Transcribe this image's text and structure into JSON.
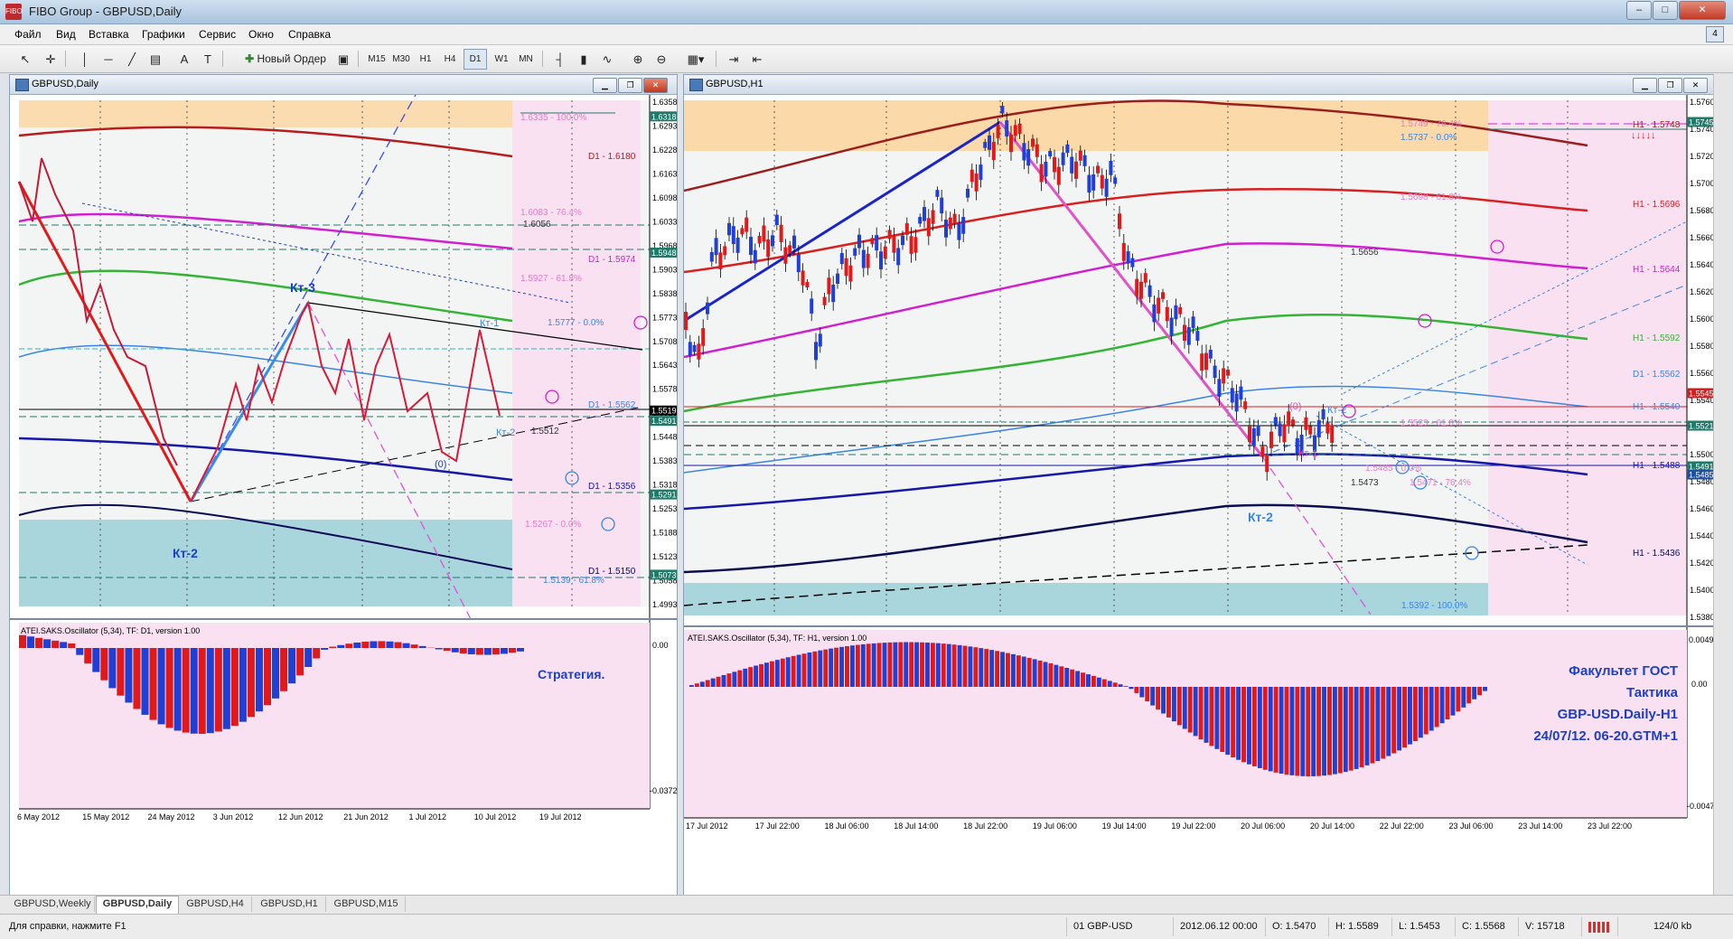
{
  "window": {
    "title": "FIBO Group - GBPUSD,Daily",
    "app_icon": "FIBO"
  },
  "menu": [
    "Файл",
    "Вид",
    "Вставка",
    "Графики",
    "Сервис",
    "Окно",
    "Справка"
  ],
  "toolbar": {
    "new_order_label": "Новый Ордер",
    "timeframes": [
      "M15",
      "M30",
      "H1",
      "H4",
      "D1",
      "W1",
      "MN"
    ],
    "active_timeframe": "D1",
    "icons": [
      "cursor-icon",
      "crosshair-icon",
      "vertical-line-icon",
      "horizontal-line-icon",
      "trendline-icon",
      "channel-icon",
      "text-icon",
      "label-icon",
      "bar-chart-icon",
      "candle-chart-icon",
      "line-chart-icon",
      "zoom-in-icon",
      "zoom-out-icon",
      "window-tile-icon",
      "autoscroll-icon",
      "shift-chart-icon"
    ]
  },
  "left_chart": {
    "title": "GBPUSD,Daily",
    "oscillator_label": "ATEI.SAKS.Oscillator (5,34), TF: D1, version 1.00",
    "osc_axis": {
      "top": "0.00",
      "bottom": "-0.03724"
    },
    "annotation_strategy": "Стратегия.",
    "waves": {
      "kt3": "Кт-3",
      "kt2": "Кт-2",
      "kt1": "Кт-1",
      "kt2b": "Кт-2",
      "zero": "(0)"
    },
    "price_axis": [
      "1.6358",
      "1.6293",
      "1.6228",
      "1.6163",
      "1.6098",
      "1.6033",
      "1.5968",
      "1.5903",
      "1.5838",
      "1.5773",
      "1.5708",
      "1.5643",
      "1.5578",
      "1.5513",
      "1.5448",
      "1.5383",
      "1.5318",
      "1.5253",
      "1.5188",
      "1.5123",
      "1.5058",
      "1.4993"
    ],
    "price_tags": [
      {
        "text": "1.6318",
        "color": "#1f7a6a"
      },
      {
        "text": "1.5948",
        "color": "#1f7a6a"
      },
      {
        "text": "1.5519",
        "color": "#000000"
      },
      {
        "text": "1.5491",
        "color": "#1f7a6a"
      },
      {
        "text": "1.5291",
        "color": "#1f7a6a"
      },
      {
        "text": "1.5073",
        "color": "#1f7a6a"
      }
    ],
    "level_labels": [
      "1.6335 - 100.0%",
      "D1 - 1.6180",
      "1.6083 - 76.4%",
      "1.6056",
      "D1 - 1.5974",
      "1.5927 - 61.8%",
      "1.5777 - 0.0%",
      "D1 - 1.5562",
      "1.5512",
      "D1 - 1.5356",
      "1.5267 - 0.0%",
      "D1 - 1.5150",
      "1.5139 - 61.8%"
    ],
    "dates": [
      "6 May 2012",
      "15 May 2012",
      "24 May 2012",
      "3 Jun 2012",
      "12 Jun 2012",
      "21 Jun 2012",
      "1 Jul 2012",
      "10 Jul 2012",
      "19 Jul 2012"
    ]
  },
  "right_chart": {
    "title": "GBPUSD,H1",
    "oscillator_label": "ATEI.SAKS.Oscillator (5,34), TF: H1, version 1.00",
    "osc_axis": {
      "top": "0.00491",
      "mid": "0.00",
      "bottom": "-0.00478"
    },
    "price_axis": [
      "1.5760",
      "1.5740",
      "1.5720",
      "1.5700",
      "1.5680",
      "1.5660",
      "1.5640",
      "1.5620",
      "1.5600",
      "1.5580",
      "1.5560",
      "1.5540",
      "1.5520",
      "1.5500",
      "1.5480",
      "1.5460",
      "1.5440",
      "1.5420",
      "1.5400",
      "1.5380"
    ],
    "price_tags": [
      {
        "text": "1.5745",
        "color": "#1f7a6a"
      },
      {
        "text": "1.5545",
        "color": "#d02020"
      },
      {
        "text": "1.5521",
        "color": "#1f7a6a"
      },
      {
        "text": "1.5491",
        "color": "#1f7a6a"
      },
      {
        "text": "1.5485",
        "color": "#1f4fa0"
      }
    ],
    "level_labels": [
      "1.5749 - 76.4%",
      "1.5737 - 0.0%",
      "H1 - 1.5748",
      "1.5698 - 61.8%",
      "H1 - 1.5696",
      "1.5656",
      "H1 - 1.5644",
      "H1 - 1.5592",
      "D1 - 1.5562",
      "H1 - 1.5540",
      "1.5523 - 61.8%",
      "H1 - 1.5488",
      "1.5485 - 0.0%",
      "1.5473",
      "1.5471 - 76.4%",
      "H1 - 1.5436",
      "1.5392 - 100.0%"
    ],
    "waves": {
      "kt2": "Кт-2",
      "kt1": "Кт-1",
      "kt2b": "Кт-2",
      "zero": "(0)"
    },
    "dates": [
      "17 Jul 2012",
      "17 Jul 22:00",
      "18 Jul 06:00",
      "18 Jul 14:00",
      "18 Jul 22:00",
      "19 Jul 06:00",
      "19 Jul 14:00",
      "19 Jul 22:00",
      "20 Jul 06:00",
      "20 Jul 14:00",
      "22 Jul 22:00",
      "23 Jul 06:00",
      "23 Jul 14:00",
      "23 Jul 22:00"
    ],
    "caption": [
      "Факультет ГОСТ",
      "Тактика",
      "GBP-USD.Daily-H1",
      "24/07/12. 06-20.GTM+1"
    ]
  },
  "tabs": [
    "GBPUSD,Weekly",
    "GBPUSD,Daily",
    "GBPUSD,H4",
    "GBPUSD,H1",
    "GBPUSD,M15"
  ],
  "active_tab": "GBPUSD,Daily",
  "status": {
    "help": "Для справки, нажмите F1",
    "profile": "01 GBP-USD",
    "datetime": "2012.06.12 00:00",
    "open": "O: 1.5470",
    "high": "H: 1.5589",
    "low": "L: 1.5453",
    "close": "C: 1.5568",
    "volume": "V: 15718",
    "traffic": "124/0 kb"
  },
  "colors": {
    "bull": "#1f3fd6",
    "bear": "#e01a1a",
    "chart_bg": "#f2f5f3",
    "pink_zone": "#f9e1f1",
    "orange_zone": "#fbd9a8",
    "teal_zone": "#a9d6dc"
  }
}
